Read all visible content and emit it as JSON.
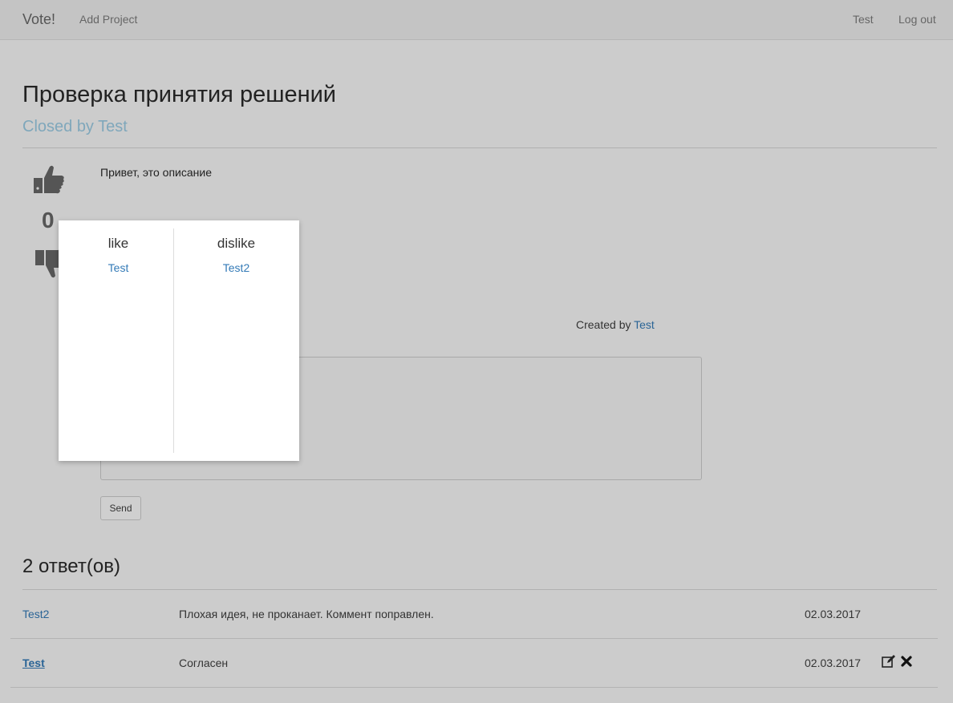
{
  "navbar": {
    "brand": "Vote!",
    "add_project": "Add Project",
    "user": "Test",
    "logout": "Log out"
  },
  "project": {
    "title": "Проверка принятия решений",
    "status_prefix": "Closed by ",
    "status_user": "Test",
    "description": "Привет, это описание",
    "vote_count": "0",
    "created_prefix": "Created by ",
    "created_user": "Test"
  },
  "comment_form": {
    "value": "",
    "send_label": "Send"
  },
  "votes_popup": {
    "like_title": "like",
    "dislike_title": "dislike",
    "likes": [
      "Test"
    ],
    "dislikes": [
      "Test2"
    ]
  },
  "answers": {
    "title": "2 ответ(ов)",
    "rows": [
      {
        "author": "Test2",
        "text": "Плохая идея, не проканает. Коммент поправлен.",
        "date": "02.03.2017"
      },
      {
        "author": "Test",
        "text": "Согласен",
        "date": "02.03.2017"
      }
    ]
  },
  "colors": {
    "background": "#cccccc",
    "link": "#2a6496",
    "muted_heading": "#7fa7bb",
    "icon": "#555555"
  }
}
